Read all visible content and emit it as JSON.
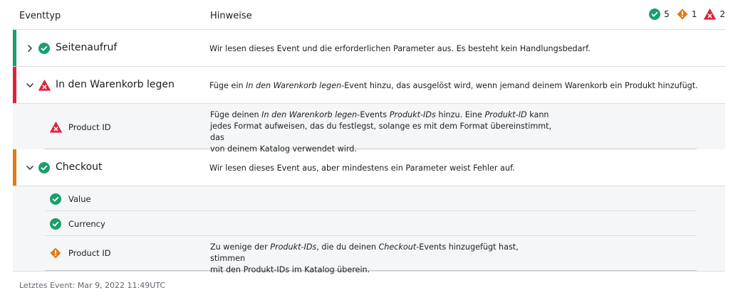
{
  "header": {
    "col_event_type": "Eventtyp",
    "col_notes": "Hinweise"
  },
  "summary": {
    "ok_count": "5",
    "warning_count": "1",
    "error_count": "2"
  },
  "colors": {
    "success": "#1a9e6c",
    "warning": "#e27b15",
    "error": "#e0223a",
    "border": "#dadde1"
  },
  "events": [
    {
      "name": "Seitenaufruf",
      "status": "success",
      "expanded": false,
      "note": "Wir lesen dieses Event und die erforderlichen Parameter aus. Es besteht kein Handlungsbedarf."
    },
    {
      "name": "In den Warenkorb legen",
      "status": "error",
      "expanded": true,
      "note_before": "Füge ein ",
      "note_em": "In den Warenkorb legen",
      "note_after": "-Event hinzu, das ausgelöst wird, wenn jemand deinem Warenkorb ein Produkt hinzufügt.",
      "params": [
        {
          "name": "Product ID",
          "status": "error",
          "note_lines": {
            "l1a": "Füge deinen ",
            "l1b": "In den Warenkorb legen",
            "l1c": "-Events ",
            "l1d": "Produkt-IDs",
            "l1e": " hinzu. Eine ",
            "l1f": "Produkt-ID",
            "l1g": " kann",
            "l2": "jedes Format aufweisen, das du festlegst, solange es mit dem Format übereinstimmt, das",
            "l3": "von deinem Katalog verwendet wird."
          }
        }
      ]
    },
    {
      "name": "Checkout",
      "status": "success",
      "expanded": true,
      "note": "Wir lesen dieses Event aus, aber mindestens ein Parameter weist Fehler auf.",
      "params": [
        {
          "name": "Value",
          "status": "success"
        },
        {
          "name": "Currency",
          "status": "success"
        },
        {
          "name": "Product ID",
          "status": "warning",
          "note_lines": {
            "l1a": "Zu wenige der ",
            "l1b": "Produkt-IDs",
            "l1c": ", die du deinen ",
            "l1d": "Checkout",
            "l1e": "-Events hinzugefügt hast, stimmen",
            "l2": "mit den Produkt-IDs im Katalog überein."
          }
        }
      ]
    }
  ],
  "footer": {
    "last_event": "Letztes Event: Mar 9, 2022 11:49UTC"
  }
}
